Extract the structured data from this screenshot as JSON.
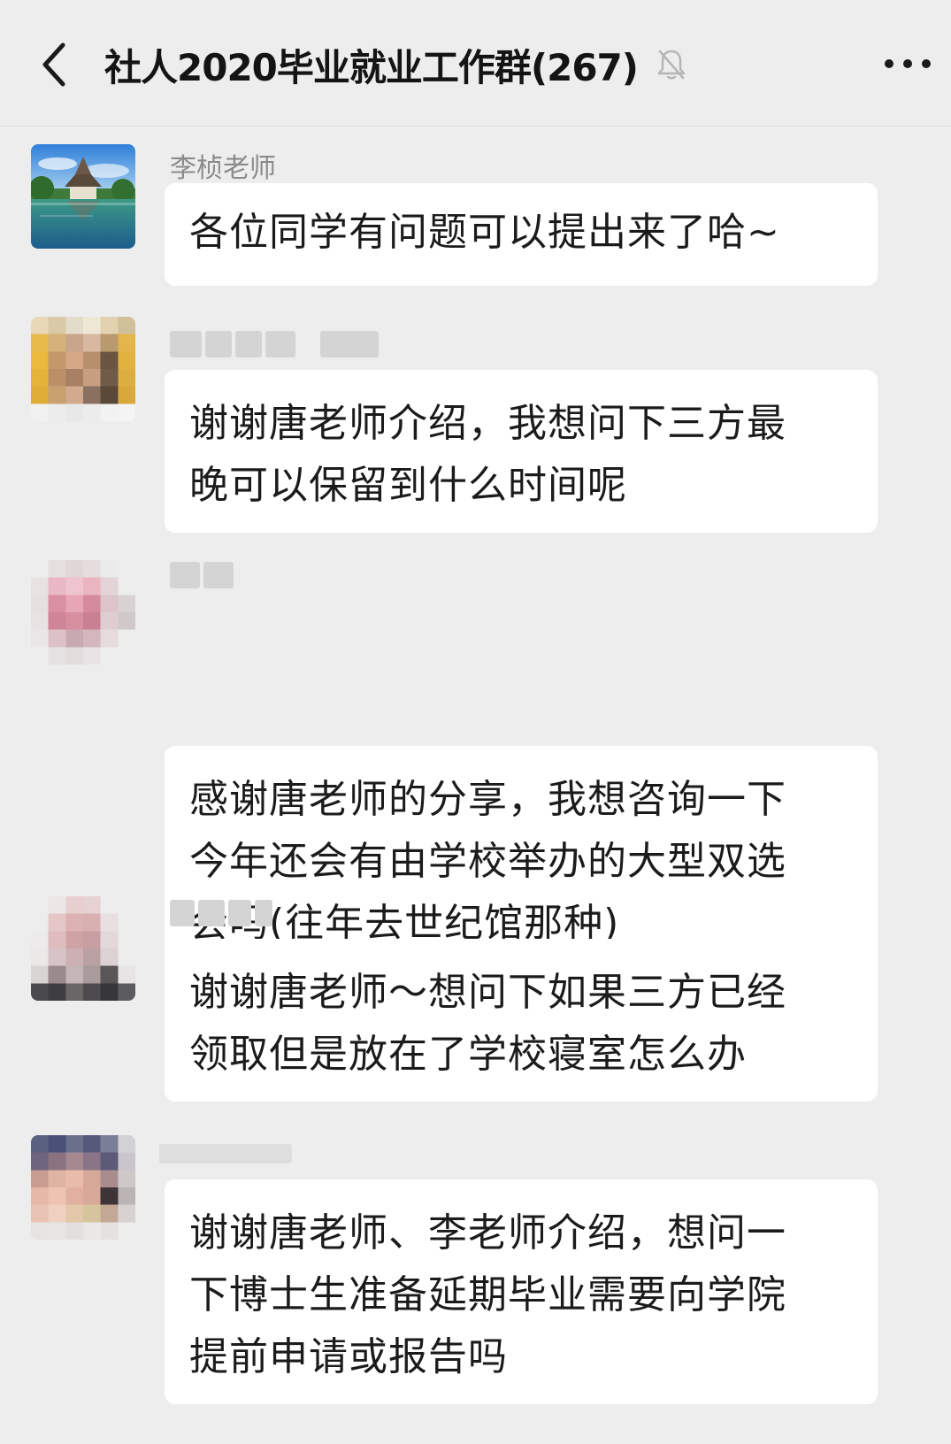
{
  "header": {
    "back_icon": "chevron-left-icon",
    "title": "社人2020毕业就业工作群(267)",
    "mute_icon": "bell-muted-icon",
    "more_icon": "more-dots-icon"
  },
  "messages": [
    {
      "sender": "李桢老师",
      "avatar": "landscape-photo",
      "lines": [
        "各位同学有问题可以提出来了哈~"
      ]
    },
    {
      "sender": "",
      "avatar": "pixelated-photo",
      "lines": [
        "谢谢唐老师介绍，我想问下三方最",
        "晚可以保留到什么时间呢"
      ]
    },
    {
      "sender": "",
      "avatar": "pixelated-photo",
      "lines": [
        "感谢唐老师的分享，我想咨询一下",
        "今年还会有由学校举办的大型双选",
        "会吗(往年去世纪馆那种)"
      ]
    },
    {
      "sender": "",
      "avatar": "pixelated-photo",
      "lines": [
        "谢谢唐老师～想问下如果三方已经",
        "领取但是放在了学校寝室怎么办"
      ]
    },
    {
      "sender": "",
      "avatar": "pixelated-photo",
      "lines": [
        "谢谢唐老师、李老师介绍，想问一",
        "下博士生准备延期毕业需要向学院",
        "提前申请或报告吗"
      ]
    }
  ]
}
